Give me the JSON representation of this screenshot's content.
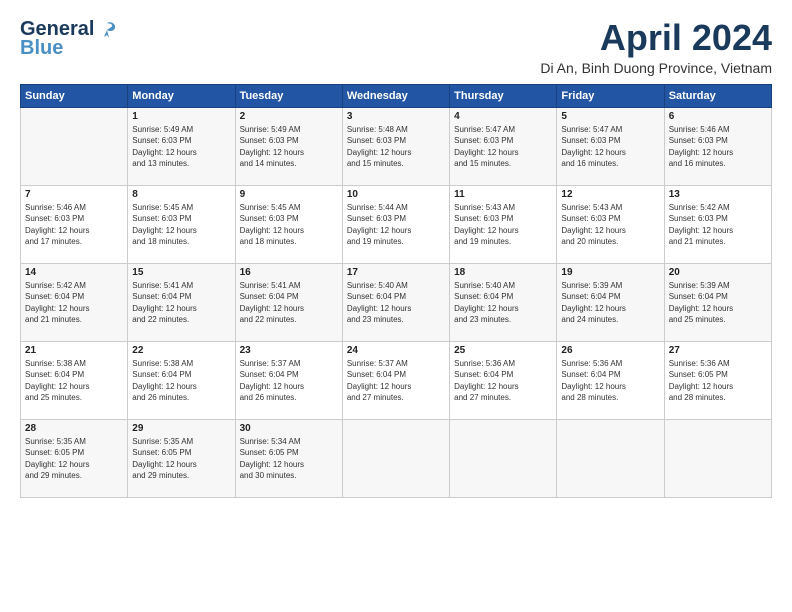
{
  "header": {
    "logo_line1": "General",
    "logo_line2": "Blue",
    "title": "April 2024",
    "subtitle": "Di An, Binh Duong Province, Vietnam"
  },
  "weekdays": [
    "Sunday",
    "Monday",
    "Tuesday",
    "Wednesday",
    "Thursday",
    "Friday",
    "Saturday"
  ],
  "weeks": [
    [
      {
        "day": "",
        "info": ""
      },
      {
        "day": "1",
        "info": "Sunrise: 5:49 AM\nSunset: 6:03 PM\nDaylight: 12 hours\nand 13 minutes."
      },
      {
        "day": "2",
        "info": "Sunrise: 5:49 AM\nSunset: 6:03 PM\nDaylight: 12 hours\nand 14 minutes."
      },
      {
        "day": "3",
        "info": "Sunrise: 5:48 AM\nSunset: 6:03 PM\nDaylight: 12 hours\nand 15 minutes."
      },
      {
        "day": "4",
        "info": "Sunrise: 5:47 AM\nSunset: 6:03 PM\nDaylight: 12 hours\nand 15 minutes."
      },
      {
        "day": "5",
        "info": "Sunrise: 5:47 AM\nSunset: 6:03 PM\nDaylight: 12 hours\nand 16 minutes."
      },
      {
        "day": "6",
        "info": "Sunrise: 5:46 AM\nSunset: 6:03 PM\nDaylight: 12 hours\nand 16 minutes."
      }
    ],
    [
      {
        "day": "7",
        "info": "Sunrise: 5:46 AM\nSunset: 6:03 PM\nDaylight: 12 hours\nand 17 minutes."
      },
      {
        "day": "8",
        "info": "Sunrise: 5:45 AM\nSunset: 6:03 PM\nDaylight: 12 hours\nand 18 minutes."
      },
      {
        "day": "9",
        "info": "Sunrise: 5:45 AM\nSunset: 6:03 PM\nDaylight: 12 hours\nand 18 minutes."
      },
      {
        "day": "10",
        "info": "Sunrise: 5:44 AM\nSunset: 6:03 PM\nDaylight: 12 hours\nand 19 minutes."
      },
      {
        "day": "11",
        "info": "Sunrise: 5:43 AM\nSunset: 6:03 PM\nDaylight: 12 hours\nand 19 minutes."
      },
      {
        "day": "12",
        "info": "Sunrise: 5:43 AM\nSunset: 6:03 PM\nDaylight: 12 hours\nand 20 minutes."
      },
      {
        "day": "13",
        "info": "Sunrise: 5:42 AM\nSunset: 6:03 PM\nDaylight: 12 hours\nand 21 minutes."
      }
    ],
    [
      {
        "day": "14",
        "info": "Sunrise: 5:42 AM\nSunset: 6:04 PM\nDaylight: 12 hours\nand 21 minutes."
      },
      {
        "day": "15",
        "info": "Sunrise: 5:41 AM\nSunset: 6:04 PM\nDaylight: 12 hours\nand 22 minutes."
      },
      {
        "day": "16",
        "info": "Sunrise: 5:41 AM\nSunset: 6:04 PM\nDaylight: 12 hours\nand 22 minutes."
      },
      {
        "day": "17",
        "info": "Sunrise: 5:40 AM\nSunset: 6:04 PM\nDaylight: 12 hours\nand 23 minutes."
      },
      {
        "day": "18",
        "info": "Sunrise: 5:40 AM\nSunset: 6:04 PM\nDaylight: 12 hours\nand 23 minutes."
      },
      {
        "day": "19",
        "info": "Sunrise: 5:39 AM\nSunset: 6:04 PM\nDaylight: 12 hours\nand 24 minutes."
      },
      {
        "day": "20",
        "info": "Sunrise: 5:39 AM\nSunset: 6:04 PM\nDaylight: 12 hours\nand 25 minutes."
      }
    ],
    [
      {
        "day": "21",
        "info": "Sunrise: 5:38 AM\nSunset: 6:04 PM\nDaylight: 12 hours\nand 25 minutes."
      },
      {
        "day": "22",
        "info": "Sunrise: 5:38 AM\nSunset: 6:04 PM\nDaylight: 12 hours\nand 26 minutes."
      },
      {
        "day": "23",
        "info": "Sunrise: 5:37 AM\nSunset: 6:04 PM\nDaylight: 12 hours\nand 26 minutes."
      },
      {
        "day": "24",
        "info": "Sunrise: 5:37 AM\nSunset: 6:04 PM\nDaylight: 12 hours\nand 27 minutes."
      },
      {
        "day": "25",
        "info": "Sunrise: 5:36 AM\nSunset: 6:04 PM\nDaylight: 12 hours\nand 27 minutes."
      },
      {
        "day": "26",
        "info": "Sunrise: 5:36 AM\nSunset: 6:04 PM\nDaylight: 12 hours\nand 28 minutes."
      },
      {
        "day": "27",
        "info": "Sunrise: 5:36 AM\nSunset: 6:05 PM\nDaylight: 12 hours\nand 28 minutes."
      }
    ],
    [
      {
        "day": "28",
        "info": "Sunrise: 5:35 AM\nSunset: 6:05 PM\nDaylight: 12 hours\nand 29 minutes."
      },
      {
        "day": "29",
        "info": "Sunrise: 5:35 AM\nSunset: 6:05 PM\nDaylight: 12 hours\nand 29 minutes."
      },
      {
        "day": "30",
        "info": "Sunrise: 5:34 AM\nSunset: 6:05 PM\nDaylight: 12 hours\nand 30 minutes."
      },
      {
        "day": "",
        "info": ""
      },
      {
        "day": "",
        "info": ""
      },
      {
        "day": "",
        "info": ""
      },
      {
        "day": "",
        "info": ""
      }
    ]
  ]
}
